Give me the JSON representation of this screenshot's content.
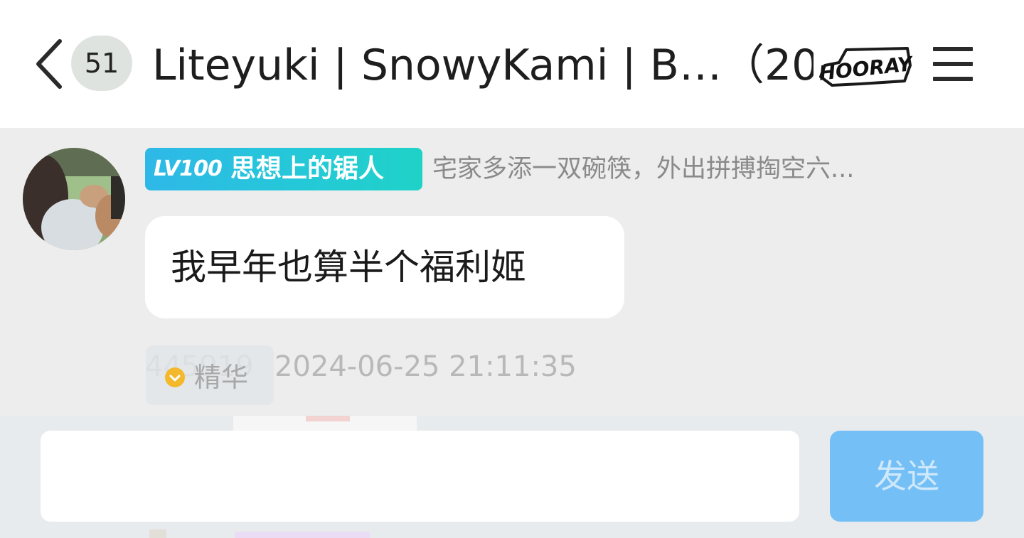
{
  "header": {
    "unread_count": "51",
    "group_title": "Liteyuki | SnowyKami | B…（206）",
    "sticker_text": "HOORAY"
  },
  "message": {
    "level": "LV100",
    "sender_name": "思想上的锯人",
    "sender_title": "宅家多添一双碗筷，外出拼搏掏空六...",
    "text": "我早年也算半个福利姬",
    "user_id": "445919",
    "essence_label": "精华",
    "timestamp": "2024-06-25 21:11:35"
  },
  "input": {
    "value": "",
    "placeholder": "",
    "send_label": "发送"
  },
  "colors": {
    "badge_gradient_start": "#2eb8e8",
    "badge_gradient_end": "#1fd2c8",
    "send_button": "#74c0f6",
    "chat_background": "#ededed"
  },
  "icons": [
    "back-icon",
    "menu-icon",
    "hooray-sticker",
    "essence-icon",
    "avatar"
  ]
}
